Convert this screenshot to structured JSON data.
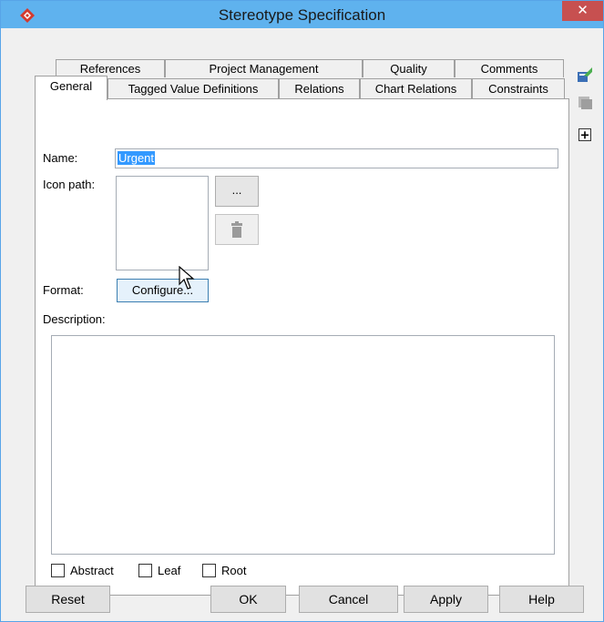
{
  "window": {
    "title": "Stereotype Specification",
    "close_glyph": "✕"
  },
  "tabs": {
    "row1": [
      "References",
      "Project Management",
      "Quality",
      "Comments"
    ],
    "row2": [
      "General",
      "Tagged Value Definitions",
      "Relations",
      "Chart Relations",
      "Constraints"
    ],
    "selected": "General"
  },
  "general": {
    "name_label": "Name:",
    "name_value": "Urgent",
    "icon_path_label": "Icon path:",
    "browse_label": "...",
    "format_label": "Format:",
    "configure_label": "Configure...",
    "description_label": "Description:",
    "description_value": "",
    "checkboxes": [
      {
        "label": "Abstract",
        "checked": false
      },
      {
        "label": "Leaf",
        "checked": false
      },
      {
        "label": "Root",
        "checked": false
      }
    ]
  },
  "buttons": {
    "reset": "Reset",
    "ok": "OK",
    "cancel": "Cancel",
    "apply": "Apply",
    "help": "Help"
  },
  "side_toolbar": [
    "model-element-icon",
    "stereotype-icon",
    "add-icon"
  ],
  "colors": {
    "title_bar": "#5fb2ee",
    "close": "#c75050",
    "selection": "#3399ff",
    "accent_border": "#3c7fb1"
  }
}
